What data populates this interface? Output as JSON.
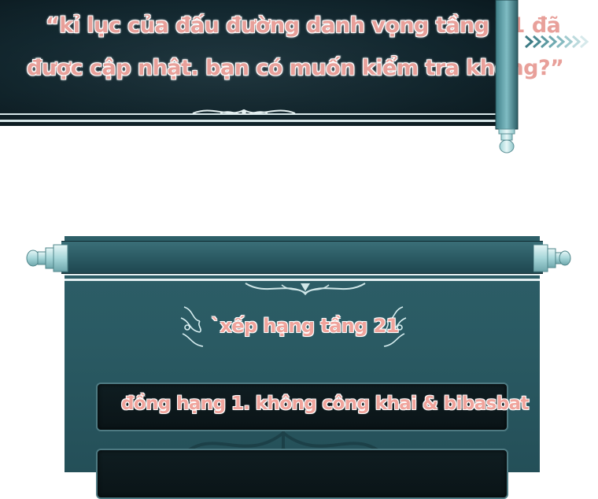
{
  "notice": {
    "line1": "“kỉ lục của đấu đường danh vọng tầng 21 đã",
    "line2": "được cập nhật. bạn có muốn kiểm tra không?”"
  },
  "ranking": {
    "title": "`xếp hạng tầng 21",
    "entries": [
      {
        "text": "đồng hạng 1. không công khai & bibasbat"
      }
    ]
  },
  "colors": {
    "text": "#f0a49c",
    "scroll_dark": "#142a32",
    "scroll_teal": "#2a5a63"
  }
}
